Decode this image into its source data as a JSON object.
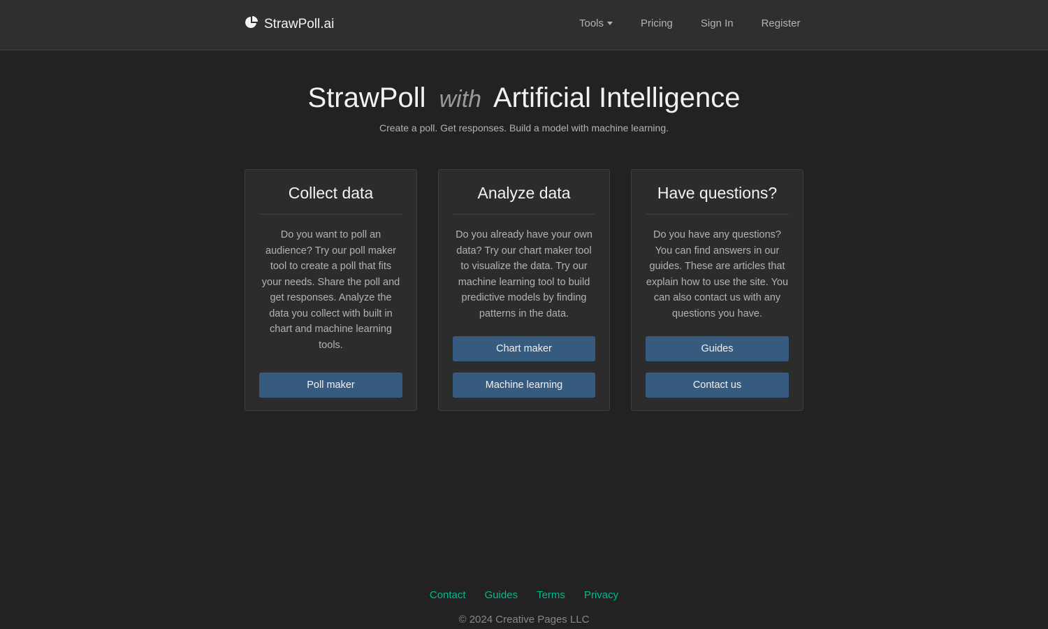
{
  "navbar": {
    "brand": "StrawPoll.ai",
    "brand_icon": "pie-chart-icon",
    "links": [
      {
        "label": "Tools",
        "dropdown": true
      },
      {
        "label": "Pricing"
      },
      {
        "label": "Sign In"
      },
      {
        "label": "Register"
      }
    ]
  },
  "hero": {
    "title_part1": "StrawPoll",
    "title_with": "with",
    "title_part2": "Artificial Intelligence",
    "subtitle": "Create a poll. Get responses. Build a model with machine learning."
  },
  "cards": [
    {
      "title": "Collect data",
      "text": "Do you want to poll an audience? Try our poll maker tool to create a poll that fits your needs. Share the poll and get responses. Analyze the data you collect with built in chart and machine learning tools.",
      "buttons": [
        "Poll maker"
      ]
    },
    {
      "title": "Analyze data",
      "text": "Do you already have your own data? Try our chart maker tool to visualize the data. Try our machine learning tool to build predictive models by finding patterns in the data.",
      "buttons": [
        "Chart maker",
        "Machine learning"
      ]
    },
    {
      "title": "Have questions?",
      "text": "Do you have any questions? You can find answers in our guides. These are articles that explain how to use the site. You can also contact us with any questions you have.",
      "buttons": [
        "Guides",
        "Contact us"
      ]
    }
  ],
  "footer": {
    "links": [
      "Contact",
      "Guides",
      "Terms",
      "Privacy"
    ],
    "copyright": "© 2024 Creative Pages LLC"
  },
  "colors": {
    "background": "#222222",
    "navbar": "#2f2f2f",
    "card": "#2c2c2c",
    "button": "#375a7f",
    "footer_link": "#00bc8c"
  }
}
